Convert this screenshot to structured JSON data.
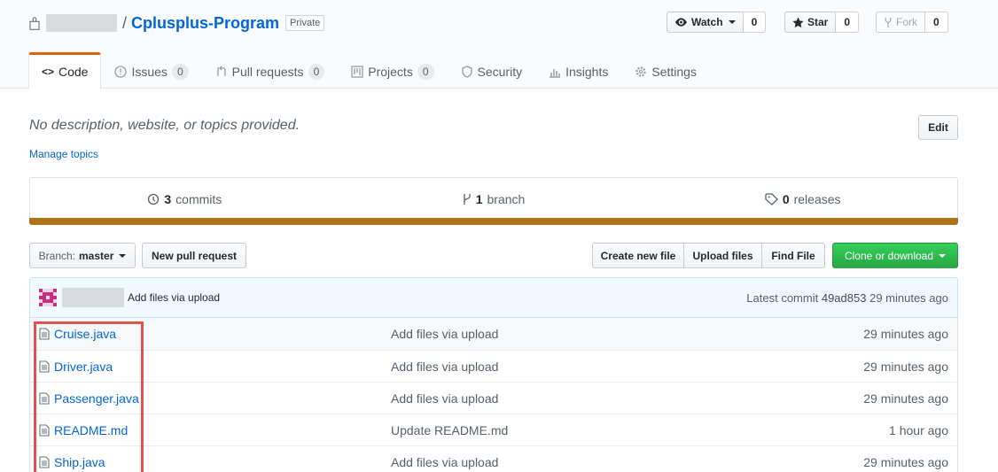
{
  "repo": {
    "name": "Cplusplus-Program",
    "separator": "/",
    "visibility": "Private"
  },
  "actions": {
    "watch_label": "Watch",
    "watch_count": "0",
    "star_label": "Star",
    "star_count": "0",
    "fork_label": "Fork",
    "fork_count": "0"
  },
  "nav": {
    "code": "Code",
    "issues": "Issues",
    "issues_count": "0",
    "pulls": "Pull requests",
    "pulls_count": "0",
    "projects": "Projects",
    "projects_count": "0",
    "security": "Security",
    "insights": "Insights",
    "settings": "Settings"
  },
  "about": {
    "description": "No description, website, or topics provided.",
    "manage_topics": "Manage topics",
    "edit": "Edit"
  },
  "summary": {
    "commits_num": "3",
    "commits_label": "commits",
    "branch_num": "1",
    "branch_label": "branch",
    "releases_num": "0",
    "releases_label": "releases",
    "language_color": "#b07219"
  },
  "toolbar": {
    "branch_prefix": "Branch:",
    "branch_name": "master",
    "new_pr": "New pull request",
    "create_file": "Create new file",
    "upload_files": "Upload files",
    "find_file": "Find File",
    "clone": "Clone or download"
  },
  "latest_commit": {
    "message": "Add files via upload",
    "prefix": "Latest commit",
    "sha": "49ad853",
    "age": "29 minutes ago"
  },
  "files": [
    {
      "name": "Cruise.java",
      "message": "Add files via upload",
      "age": "29 minutes ago"
    },
    {
      "name": "Driver.java",
      "message": "Add files via upload",
      "age": "29 minutes ago"
    },
    {
      "name": "Passenger.java",
      "message": "Add files via upload",
      "age": "29 minutes ago"
    },
    {
      "name": "README.md",
      "message": "Update README.md",
      "age": "1 hour ago"
    },
    {
      "name": "Ship.java",
      "message": "Add files via upload",
      "age": "29 minutes ago"
    }
  ],
  "colors": {
    "link": "#0366d6",
    "primary_button": "#28a745",
    "highlight": "#e05353",
    "selected_tab": "#e36209"
  }
}
